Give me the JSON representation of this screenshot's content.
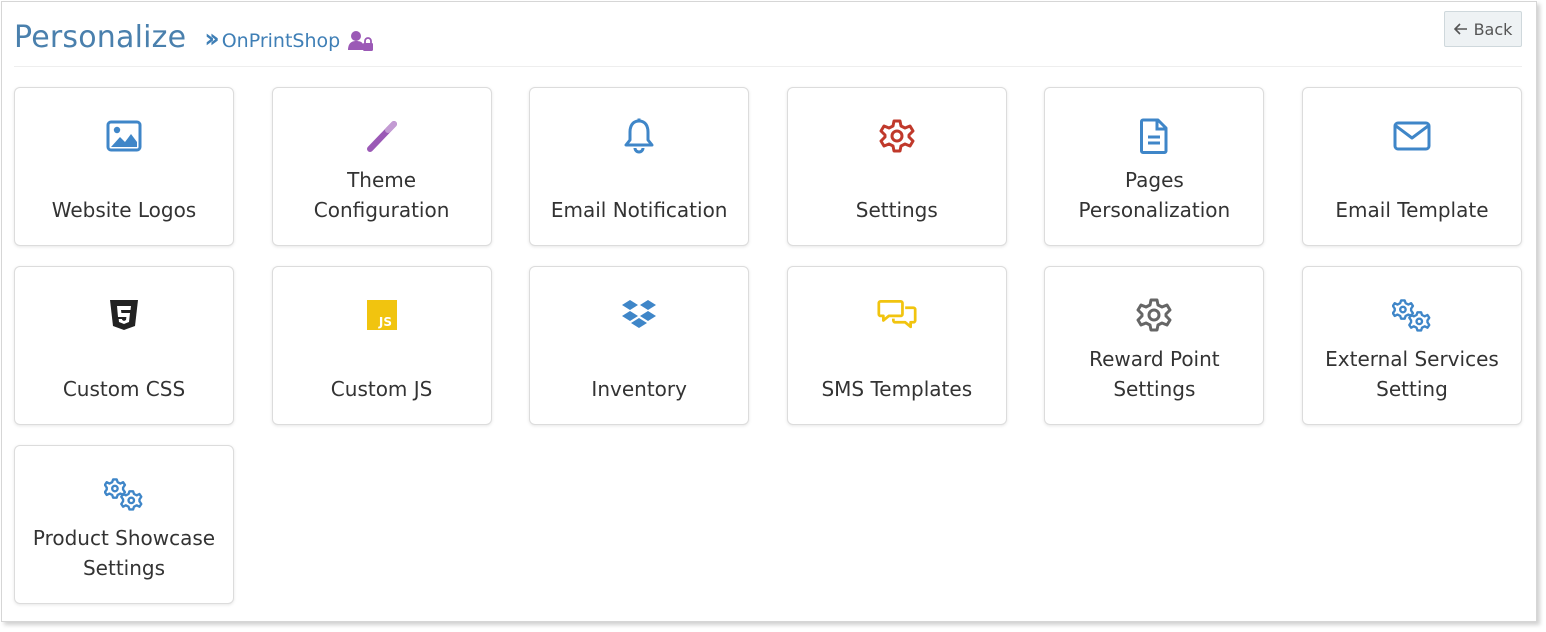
{
  "header": {
    "title": "Personalize",
    "separator": "»",
    "store_link": "OnPrintShop",
    "back_label": "Back"
  },
  "colors": {
    "title": "#4a80ad",
    "link": "#3f7fb6",
    "icon_blue": "#3f86c8",
    "icon_purple": "#9b59b6",
    "icon_red": "#c0392b",
    "icon_yellow": "#f1c40f",
    "icon_gray": "#666666",
    "icon_black": "#222222"
  },
  "tiles": [
    {
      "label": "Website Logos",
      "icon": "image-icon"
    },
    {
      "label": "Theme\nConfiguration",
      "icon": "magic-wand-icon"
    },
    {
      "label": "Email Notification",
      "icon": "bell-icon"
    },
    {
      "label": "Settings",
      "icon": "gear-icon"
    },
    {
      "label": "Pages\nPersonalization",
      "icon": "file-icon"
    },
    {
      "label": "Email Template",
      "icon": "envelope-icon"
    },
    {
      "label": "Custom CSS",
      "icon": "css3-icon"
    },
    {
      "label": "Custom JS",
      "icon": "js-icon"
    },
    {
      "label": "Inventory",
      "icon": "dropbox-icon"
    },
    {
      "label": "SMS Templates",
      "icon": "chat-bubbles-icon"
    },
    {
      "label": "Reward Point\nSettings",
      "icon": "gear-icon"
    },
    {
      "label": "External Services\nSetting",
      "icon": "gears-icon"
    },
    {
      "label": "Product Showcase\nSettings",
      "icon": "gears-icon"
    }
  ]
}
